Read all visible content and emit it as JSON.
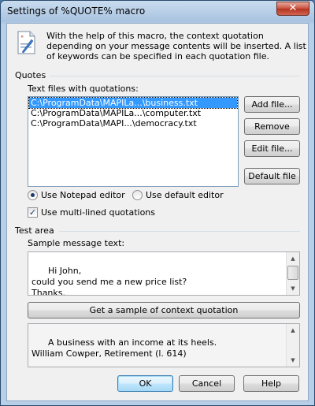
{
  "window": {
    "title": "Settings of %QUOTE% macro",
    "close_glyph": "✕"
  },
  "intro": {
    "text": "With the help of this macro, the context quotation depending on your message contents will be inserted. A list of keywords can be specified in each quotation file."
  },
  "quotes": {
    "group_label": "Quotes",
    "files_label": "Text files with quotations:",
    "files": [
      "C:\\ProgramData\\MAPILa...\\business.txt",
      "C:\\ProgramData\\MAPILa...\\computer.txt",
      "C:\\ProgramData\\MAPI...\\democracy.txt"
    ],
    "selected_index": 0,
    "buttons": {
      "add": "Add file...",
      "remove": "Remove",
      "edit": "Edit file...",
      "default": "Default file"
    },
    "editor_notepad": "Use Notepad editor",
    "editor_default": "Use default editor",
    "multiline": "Use multi-lined quotations"
  },
  "test": {
    "group_label": "Test area",
    "sample_label": "Sample message text:",
    "sample_text": "Hi John,\ncould you send me a new price list?\nThanks.",
    "get_sample_button": "Get a sample of context quotation",
    "result_text": "A business with an income at its heels.\nWilliam Cowper, Retirement (l. 614)"
  },
  "footer": {
    "ok": "OK",
    "cancel": "Cancel",
    "help": "Help"
  },
  "colors": {
    "selection": "#3399ff",
    "title_bar": "#b8cfe8",
    "close": "#c8503c"
  }
}
